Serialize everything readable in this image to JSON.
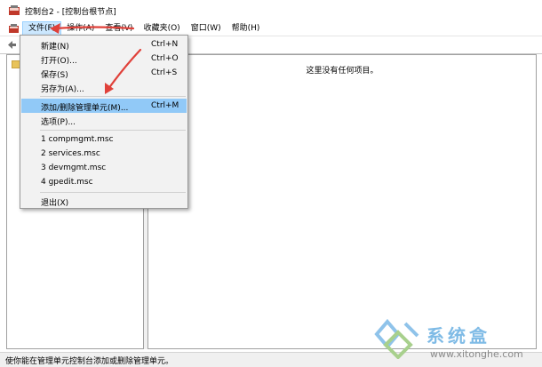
{
  "window": {
    "title": "控制台2 - [控制台根节点]"
  },
  "menubar": {
    "items": [
      "文件(F)",
      "操作(A)",
      "查看(V)",
      "收藏夹(O)",
      "窗口(W)",
      "帮助(H)"
    ]
  },
  "file_menu": {
    "items": [
      {
        "label": "新建(N)",
        "accel": "Ctrl+N"
      },
      {
        "label": "打开(O)...",
        "accel": "Ctrl+O"
      },
      {
        "label": "保存(S)",
        "accel": "Ctrl+S"
      },
      {
        "label": "另存为(A)...",
        "accel": ""
      },
      {
        "label": "添加/删除管理单元(M)...",
        "accel": "Ctrl+M"
      },
      {
        "label": "选项(P)...",
        "accel": ""
      },
      {
        "label": "1 compmgmt.msc",
        "accel": ""
      },
      {
        "label": "2 services.msc",
        "accel": ""
      },
      {
        "label": "3 devmgmt.msc",
        "accel": ""
      },
      {
        "label": "4 gpedit.msc",
        "accel": ""
      },
      {
        "label": "退出(X)",
        "accel": ""
      }
    ],
    "highlighted_index": 4
  },
  "result_pane": {
    "empty_text": "这里没有任何项目。"
  },
  "statusbar": {
    "text": "使你能在管理单元控制台添加或删除管理单元。"
  },
  "watermark": {
    "brand": "系统盒",
    "url": "www.xitonghe.com"
  },
  "colors": {
    "menu_highlight": "#91c9f7",
    "active_menu": "#cce8ff",
    "arrow": "#e0413a",
    "watermark_blue": "#7fbbe6"
  },
  "icons": [
    "console-app-icon",
    "console-mini-icon",
    "back-arrow-icon",
    "folder-icon"
  ]
}
